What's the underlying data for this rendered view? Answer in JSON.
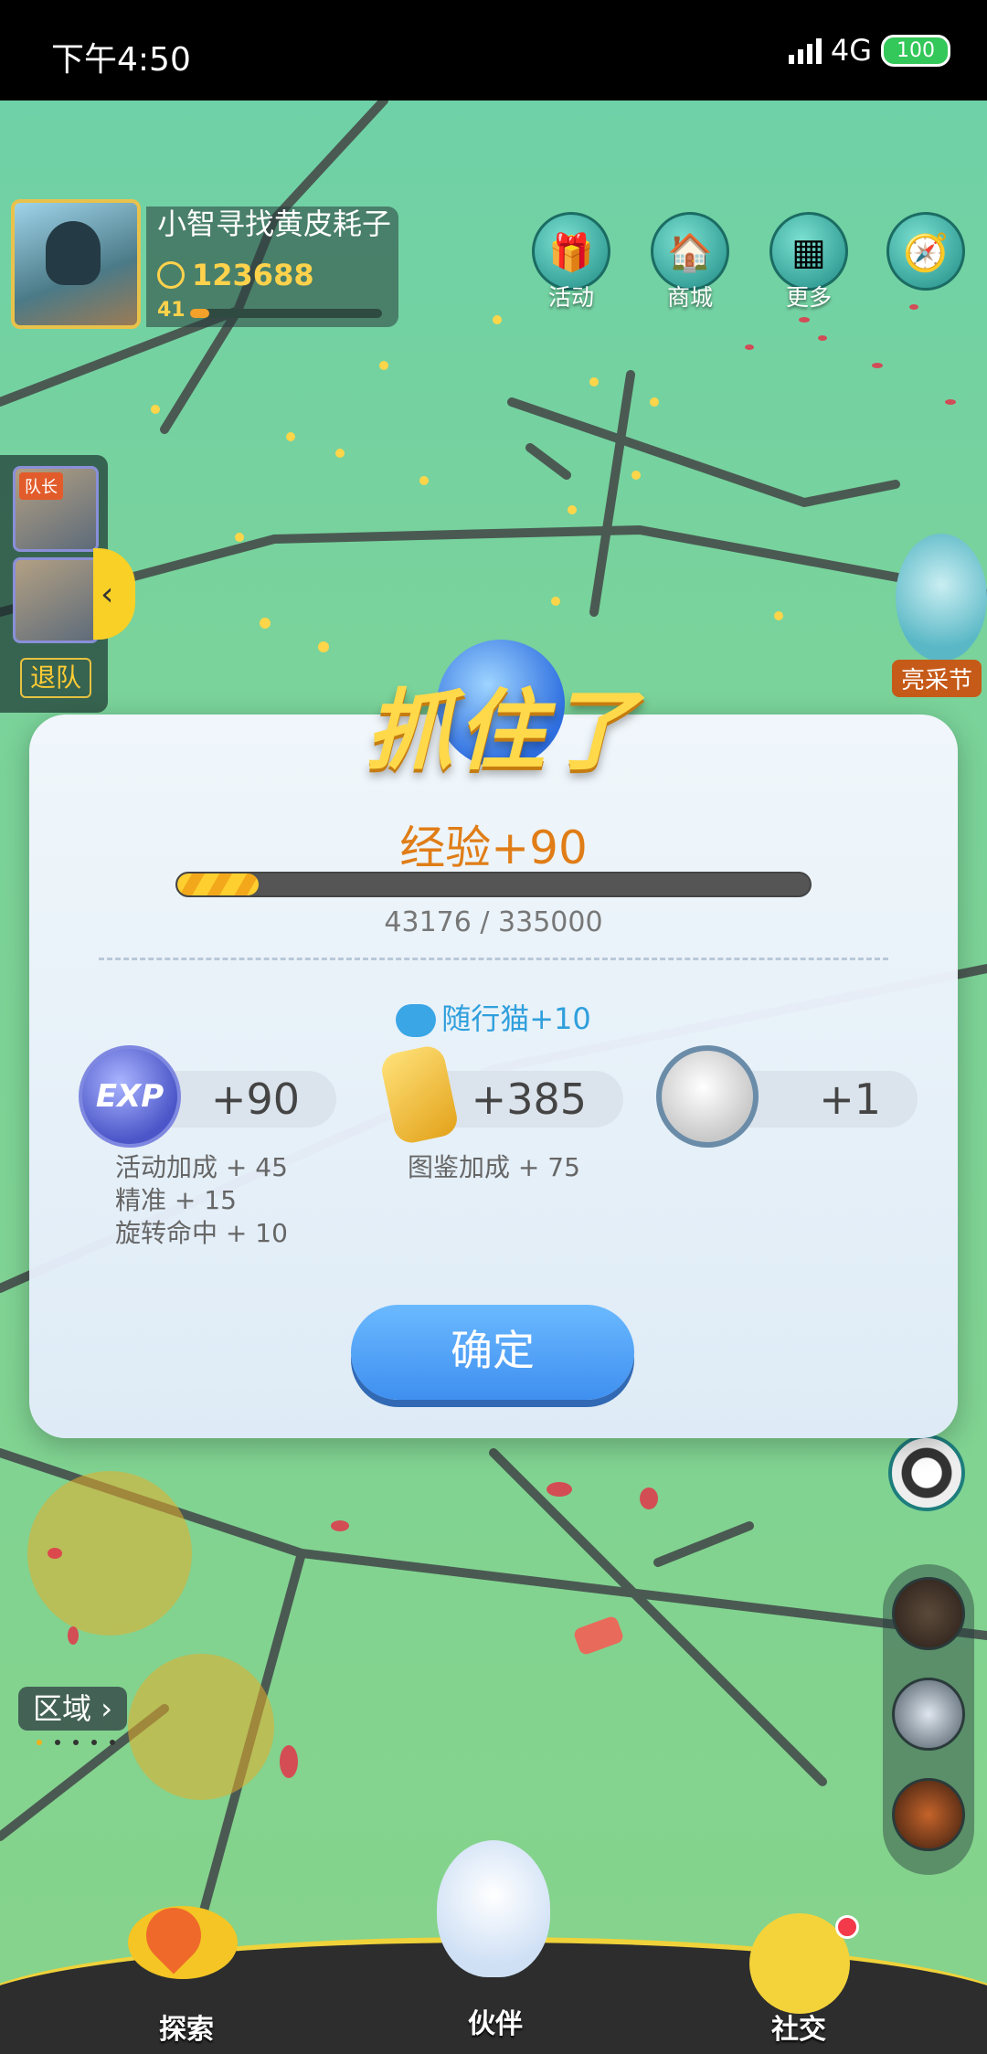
{
  "status_bar": {
    "time": "下午4:50",
    "network": "4G",
    "battery": "100"
  },
  "player": {
    "name": "小智寻找黄皮耗子",
    "coins": "123688",
    "level": "41",
    "level_progress": 0.1
  },
  "top_buttons": [
    {
      "label": "活动",
      "icon": "gift-icon"
    },
    {
      "label": "商城",
      "icon": "shop-icon"
    },
    {
      "label": "更多",
      "icon": "more-icon"
    },
    {
      "label": "",
      "icon": "compass-icon"
    }
  ],
  "team": {
    "leader_tag": "队长",
    "leave_label": "退队"
  },
  "task": {
    "label": "亮采节"
  },
  "dialog": {
    "title": "抓住了",
    "exp_gain": "经验+90",
    "exp_progress": 0.129,
    "exp_count": "43176 / 335000",
    "cat_bonus": "随行猫+10",
    "rewards": [
      {
        "icon": "exp-icon",
        "icon_text": "EXP",
        "value": "+90"
      },
      {
        "icon": "crystal-icon",
        "value": "+385"
      },
      {
        "icon": "pet-icon",
        "value": "+1"
      }
    ],
    "exp_bonuses": [
      "活动加成 + 45",
      "精准 + 15",
      "旋转命中 + 10"
    ],
    "crystal_bonus": "图鉴加成 + 75",
    "confirm_label": "确定"
  },
  "region": {
    "label": "区域"
  },
  "bottom_nav": [
    {
      "label": "探索"
    },
    {
      "label": "伙伴"
    },
    {
      "label": "社交"
    }
  ],
  "colors": {
    "accent_gold": "#ffd24c",
    "exp_orange": "#e07d17",
    "cat_blue": "#2f9fdc",
    "confirm_blue": "#4b9bf5"
  }
}
